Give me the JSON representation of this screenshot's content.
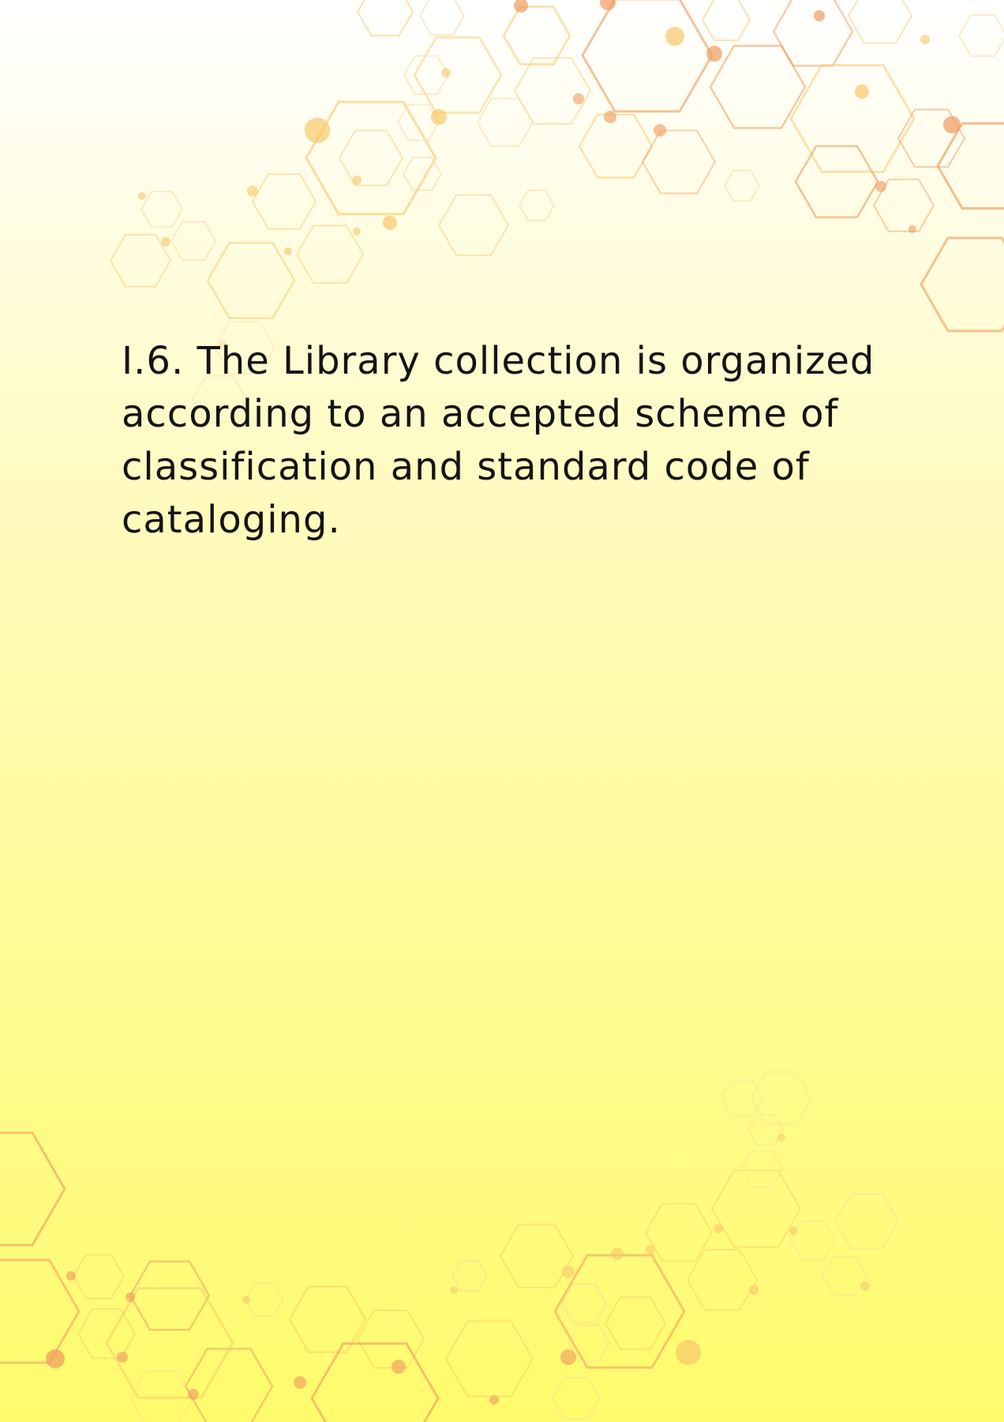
{
  "document": {
    "statement": "I.6. The Library collection is organized according to an accepted scheme of classification and standard code of cataloging."
  },
  "colors": {
    "hex_orange": "#ee9a5e",
    "hex_gold": "#f6c86a",
    "hex_light": "#f7d9a0",
    "text": "#141414"
  }
}
